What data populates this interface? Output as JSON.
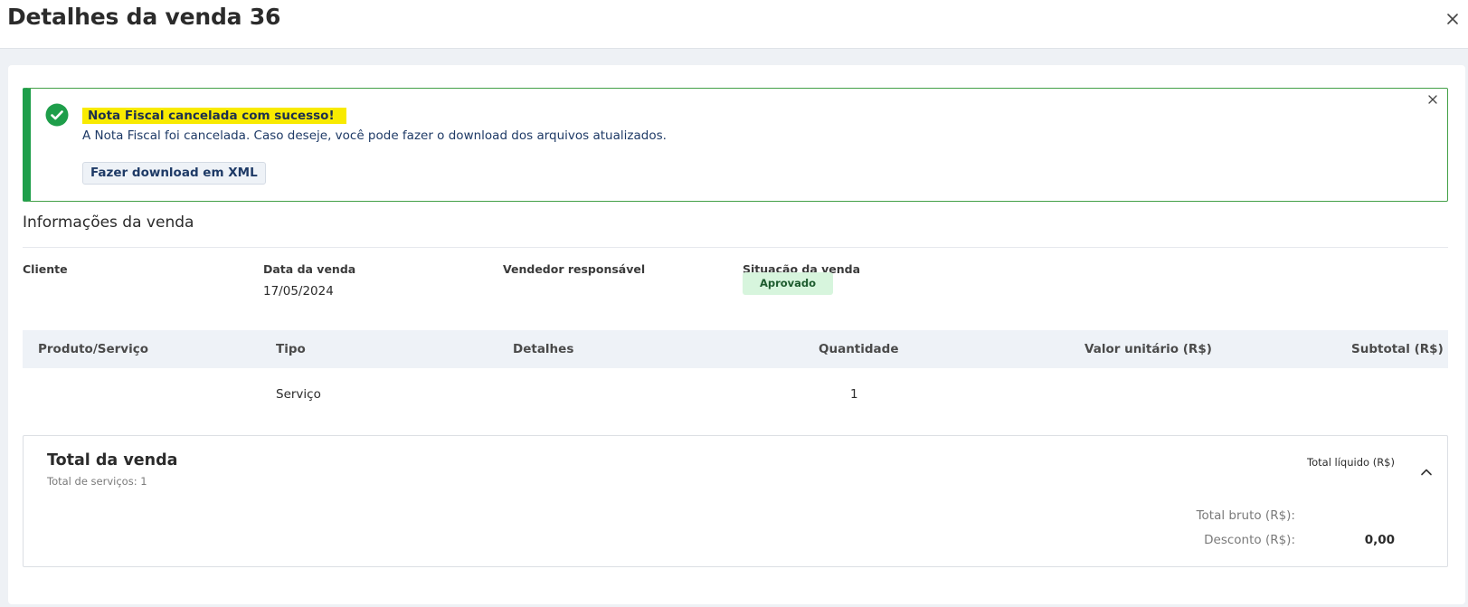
{
  "header": {
    "title": "Detalhes da venda 36",
    "close_icon": "close-icon"
  },
  "alert": {
    "icon": "check-circle-icon",
    "color": "#1e9e4a",
    "highlight_color": "#f8ea00",
    "title": "Nota Fiscal cancelada com sucesso!",
    "message": "A Nota Fiscal foi cancelada. Caso deseje, você pode fazer o download dos arquivos atualizados.",
    "button_label": "Fazer download em XML",
    "close_icon": "close-icon"
  },
  "info": {
    "section_title": "Informações da venda",
    "client_label": "Cliente",
    "client_value": "",
    "date_label": "Data da venda",
    "date_value": "17/05/2024",
    "seller_label": "Vendedor responsável",
    "seller_value": "",
    "status_label": "Situação da venda",
    "status_value": "Aprovado",
    "status_color": "#d7f5dd"
  },
  "table": {
    "headers": [
      "Produto/Serviço",
      "Tipo",
      "Detalhes",
      "Quantidade",
      "Valor unitário (R$)",
      "Subtotal (R$)"
    ],
    "rows": [
      {
        "produto": "",
        "tipo": "Serviço",
        "detalhes": "",
        "quantidade": "1",
        "valor_unitario": "",
        "subtotal": ""
      }
    ]
  },
  "total": {
    "title": "Total da venda",
    "subtitle": "Total de serviços: 1",
    "net_label": "Total líquido (R$)",
    "gross_label": "Total bruto (R$):",
    "gross_value": "",
    "discount_label": "Desconto (R$):",
    "discount_value": "0,00",
    "toggle_icon": "chevron-up-icon"
  }
}
